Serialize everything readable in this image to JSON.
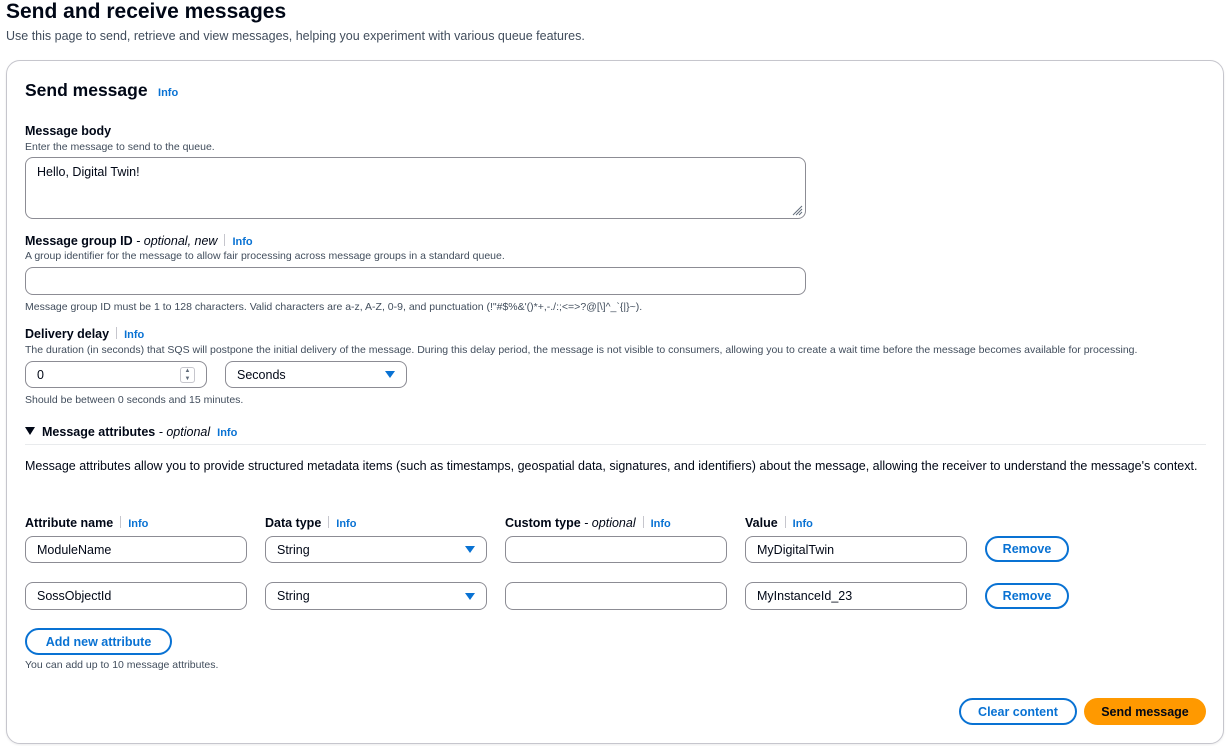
{
  "page": {
    "title": "Send and receive messages",
    "description": "Use this page to send, retrieve and view messages, helping you experiment with various queue features."
  },
  "send": {
    "title": "Send message",
    "info": "Info",
    "body": {
      "label": "Message body",
      "description": "Enter the message to send to the queue.",
      "value": "Hello, Digital Twin!"
    },
    "group_id": {
      "label": "Message group ID",
      "label_suffix": " - optional, new",
      "info": "Info",
      "description": "A group identifier for the message to allow fair processing across message groups in a standard queue.",
      "value": "",
      "constraint": "Message group ID must be 1 to 128 characters. Valid characters are a-z, A-Z, 0-9, and punctuation (!\"#$%&'()*+,-./:;<=>?@[\\]^_`{|}~)."
    },
    "delay": {
      "label": "Delivery delay",
      "info": "Info",
      "description": "The duration (in seconds) that SQS will postpone the initial delivery of the message. During this delay period, the message is not visible to consumers, allowing you to create a wait time before the message becomes available for processing.",
      "value": "0",
      "unit": "Seconds",
      "constraint": "Should be between 0 seconds and 15 minutes."
    },
    "attributes": {
      "title": "Message attributes",
      "title_suffix": " - optional",
      "info": "Info",
      "description": "Message attributes allow you to provide structured metadata items (such as timestamps, geospatial data, signatures, and identifiers) about the message, allowing the receiver to understand the message's context.",
      "columns": {
        "name": "Attribute name",
        "type": "Data type",
        "custom": "Custom type",
        "custom_suffix": " - optional",
        "value": "Value",
        "info": "Info"
      },
      "rows": [
        {
          "name": "ModuleName",
          "type": "String",
          "custom": "",
          "value": "MyDigitalTwin",
          "remove": "Remove"
        },
        {
          "name": "SossObjectId",
          "type": "String",
          "custom": "",
          "value": "MyInstanceId_23",
          "remove": "Remove"
        }
      ],
      "add_label": "Add new attribute",
      "limit_note": "You can add up to 10 message attributes."
    },
    "actions": {
      "clear": "Clear content",
      "send": "Send message"
    }
  }
}
